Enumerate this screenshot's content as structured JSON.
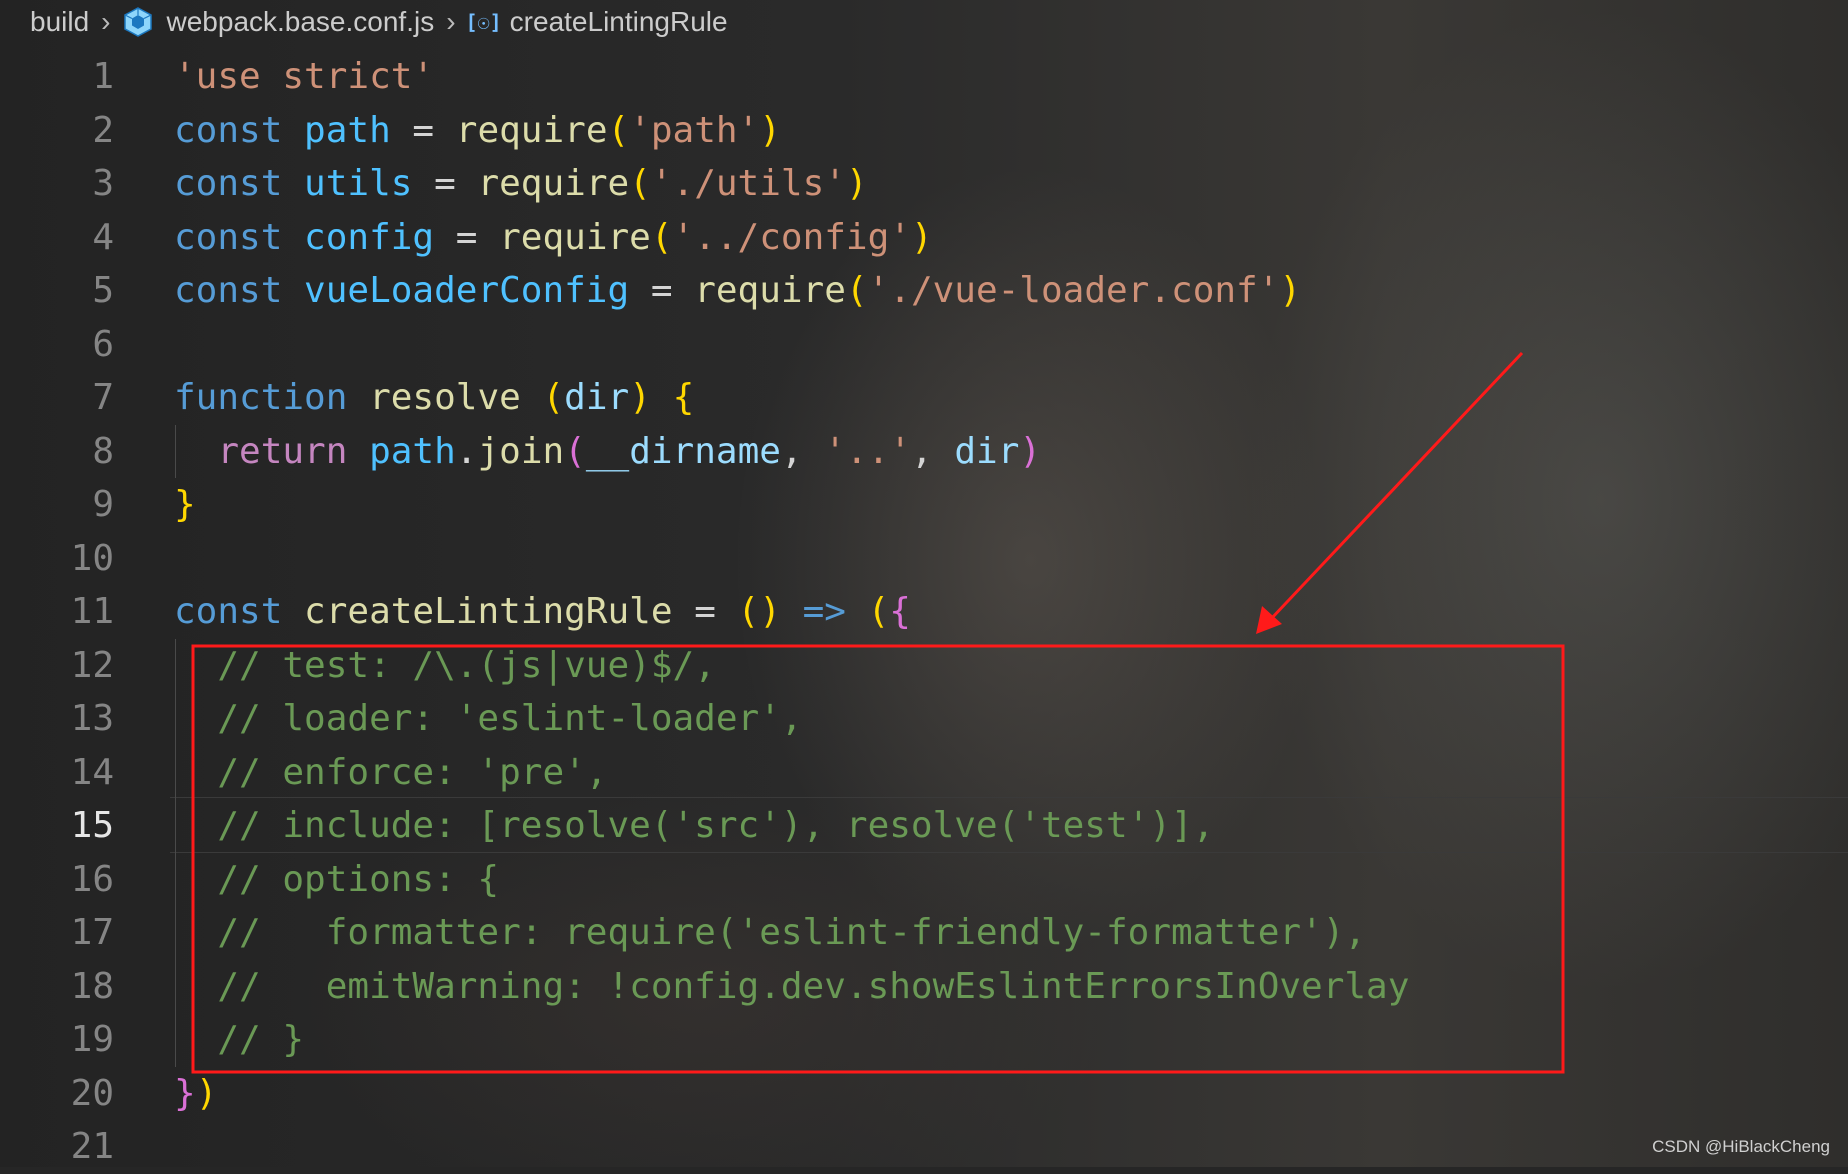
{
  "breadcrumb": {
    "folder": "build",
    "file": "webpack.base.conf.js",
    "symbol": "createLintingRule",
    "file_icon": "webpack-cube-icon",
    "symbol_icon": "symbol-variable-icon",
    "separator_icon": "chevron-right-icon"
  },
  "editor": {
    "active_line": 15,
    "line_numbers": [
      "1",
      "2",
      "3",
      "4",
      "5",
      "6",
      "7",
      "8",
      "9",
      "10",
      "11",
      "12",
      "13",
      "14",
      "15",
      "16",
      "17",
      "18",
      "19",
      "20",
      "21"
    ],
    "lines": [
      [
        {
          "t": "'use strict'",
          "c": "str"
        }
      ],
      [
        {
          "t": "const ",
          "c": "kw"
        },
        {
          "t": "path",
          "c": "var"
        },
        {
          "t": " = ",
          "c": ""
        },
        {
          "t": "require",
          "c": "fn"
        },
        {
          "t": "(",
          "c": "b1"
        },
        {
          "t": "'path'",
          "c": "str"
        },
        {
          "t": ")",
          "c": "b1"
        }
      ],
      [
        {
          "t": "const ",
          "c": "kw"
        },
        {
          "t": "utils",
          "c": "var"
        },
        {
          "t": " = ",
          "c": ""
        },
        {
          "t": "require",
          "c": "fn"
        },
        {
          "t": "(",
          "c": "b1"
        },
        {
          "t": "'./utils'",
          "c": "str"
        },
        {
          "t": ")",
          "c": "b1"
        }
      ],
      [
        {
          "t": "const ",
          "c": "kw"
        },
        {
          "t": "config",
          "c": "var"
        },
        {
          "t": " = ",
          "c": ""
        },
        {
          "t": "require",
          "c": "fn"
        },
        {
          "t": "(",
          "c": "b1"
        },
        {
          "t": "'../config'",
          "c": "str"
        },
        {
          "t": ")",
          "c": "b1"
        }
      ],
      [
        {
          "t": "const ",
          "c": "kw"
        },
        {
          "t": "vueLoaderConfig",
          "c": "var"
        },
        {
          "t": " = ",
          "c": ""
        },
        {
          "t": "require",
          "c": "fn"
        },
        {
          "t": "(",
          "c": "b1"
        },
        {
          "t": "'./vue-loader.conf'",
          "c": "str"
        },
        {
          "t": ")",
          "c": "b1"
        }
      ],
      [],
      [
        {
          "t": "function ",
          "c": "kw"
        },
        {
          "t": "resolve",
          "c": "fn"
        },
        {
          "t": " ",
          "c": ""
        },
        {
          "t": "(",
          "c": "b1"
        },
        {
          "t": "dir",
          "c": "prm"
        },
        {
          "t": ")",
          "c": "b1"
        },
        {
          "t": " ",
          "c": ""
        },
        {
          "t": "{",
          "c": "b1"
        }
      ],
      [
        {
          "t": "  return ",
          "c": "ctrl"
        },
        {
          "t": "path",
          "c": "var"
        },
        {
          "t": ".",
          "c": ""
        },
        {
          "t": "join",
          "c": "fn"
        },
        {
          "t": "(",
          "c": "b2"
        },
        {
          "t": "__dirname",
          "c": "prm"
        },
        {
          "t": ", ",
          "c": ""
        },
        {
          "t": "'..'",
          "c": "str"
        },
        {
          "t": ", ",
          "c": ""
        },
        {
          "t": "dir",
          "c": "prm"
        },
        {
          "t": ")",
          "c": "b2"
        }
      ],
      [
        {
          "t": "}",
          "c": "b1"
        }
      ],
      [],
      [
        {
          "t": "const ",
          "c": "kw"
        },
        {
          "t": "createLintingRule",
          "c": "fn"
        },
        {
          "t": " = ",
          "c": ""
        },
        {
          "t": "()",
          "c": "b1"
        },
        {
          "t": " => ",
          "c": "kw"
        },
        {
          "t": "(",
          "c": "b1"
        },
        {
          "t": "{",
          "c": "b2"
        }
      ],
      [
        {
          "t": "  // test: /\\.(js|vue)$/,",
          "c": "cmt"
        }
      ],
      [
        {
          "t": "  // loader: 'eslint-loader',",
          "c": "cmt"
        }
      ],
      [
        {
          "t": "  // enforce: 'pre',",
          "c": "cmt"
        }
      ],
      [
        {
          "t": "  // include: [resolve('src'), resolve('test')],",
          "c": "cmt"
        }
      ],
      [
        {
          "t": "  // options: {",
          "c": "cmt"
        }
      ],
      [
        {
          "t": "  //   formatter: require('eslint-friendly-formatter'),",
          "c": "cmt"
        }
      ],
      [
        {
          "t": "  //   emitWarning: !config.dev.showEslintErrorsInOverlay",
          "c": "cmt"
        }
      ],
      [
        {
          "t": "  // }",
          "c": "cmt"
        }
      ],
      [
        {
          "t": "}",
          "c": "b2"
        },
        {
          "t": ")",
          "c": "b1"
        }
      ],
      []
    ]
  },
  "annotation": {
    "box_color": "#ff1a1a",
    "arrow_color": "#ff1a1a"
  },
  "watermark": "CSDN @HiBlackCheng"
}
